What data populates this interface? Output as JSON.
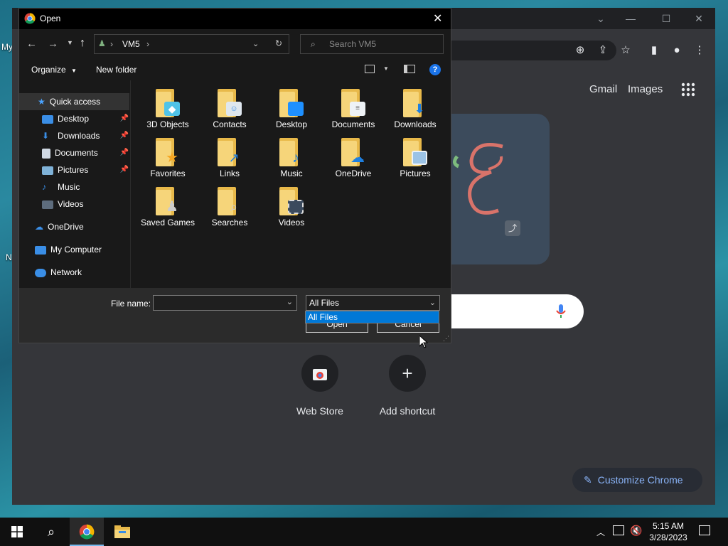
{
  "dialog": {
    "title": "Open",
    "address": {
      "current": "VM5"
    },
    "search_placeholder": "Search VM5",
    "commands": {
      "organize": "Organize",
      "new_folder": "New folder"
    },
    "nav": {
      "quick_access": "Quick access",
      "items": [
        "Desktop",
        "Downloads",
        "Documents",
        "Pictures",
        "Music",
        "Videos"
      ],
      "onedrive": "OneDrive",
      "my_computer": "My Computer",
      "network": "Network"
    },
    "files": [
      "3D Objects",
      "Contacts",
      "Desktop",
      "Documents",
      "Downloads",
      "Favorites",
      "Links",
      "Music",
      "OneDrive",
      "Pictures",
      "Saved Games",
      "Searches",
      "Videos"
    ],
    "file_name_label": "File name:",
    "file_name_value": "",
    "filter_value": "All Files",
    "filter_options": [
      "All Files"
    ],
    "open_label": "Open",
    "cancel_label": "Cancel"
  },
  "chrome": {
    "gmail": "Gmail",
    "images": "Images",
    "shortcuts": [
      "Web Store",
      "Add shortcut"
    ],
    "customize": "Customize Chrome"
  },
  "desktop": {
    "label_fragment_1": "My",
    "label_fragment_2": "N"
  },
  "taskbar": {
    "time": "5:15 AM",
    "date": "3/28/2023"
  },
  "colors": {
    "accent": "#0078d7",
    "chrome_link": "#8ab4f8"
  }
}
